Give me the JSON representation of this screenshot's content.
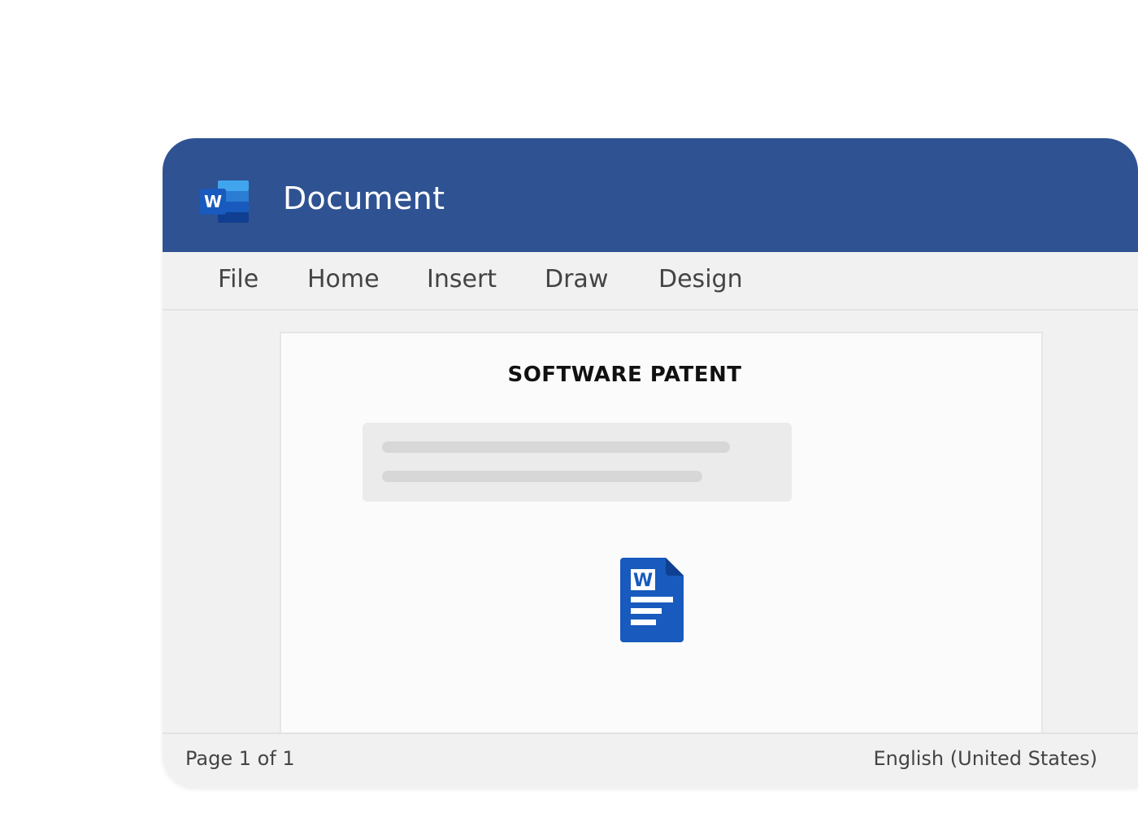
{
  "window": {
    "title": "Document",
    "app_icon": "word-logo-icon"
  },
  "ribbon": {
    "tabs": [
      {
        "label": "File"
      },
      {
        "label": "Home"
      },
      {
        "label": "Insert"
      },
      {
        "label": "Draw"
      },
      {
        "label": "Design"
      }
    ]
  },
  "document": {
    "heading": "SOFTWARE PATENT",
    "file_icon": "word-document-icon"
  },
  "status": {
    "page_info": "Page 1 of 1",
    "language": "English (United States)"
  },
  "colors": {
    "titlebar": "#2f5292",
    "word_blue": "#185abd",
    "background": "#f1f1f1"
  }
}
